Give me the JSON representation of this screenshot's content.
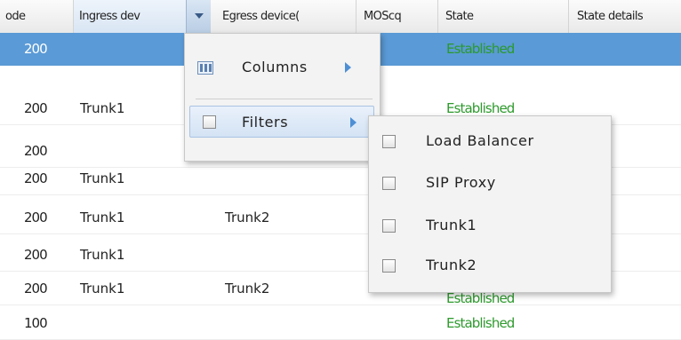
{
  "grid": {
    "columns": [
      {
        "key": "code",
        "label": "ode"
      },
      {
        "key": "ingress",
        "label": "Ingress dev"
      },
      {
        "key": "egress",
        "label": "Egress device("
      },
      {
        "key": "mos",
        "label": "MOScq"
      },
      {
        "key": "state",
        "label": "State"
      },
      {
        "key": "state_details",
        "label": "State details"
      }
    ],
    "rows": [
      {
        "code": "200",
        "ingress": "",
        "egress": "",
        "state": "Established",
        "selected": true
      },
      {
        "code": "200",
        "ingress": "Trunk1",
        "egress": "",
        "state": "Established",
        "selected": false
      },
      {
        "code": "200",
        "ingress": "",
        "egress": "",
        "state": "",
        "selected": false
      },
      {
        "code": "200",
        "ingress": "Trunk1",
        "egress": "",
        "state": "",
        "selected": false
      },
      {
        "code": "200",
        "ingress": "Trunk1",
        "egress": "Trunk2",
        "state": "",
        "selected": false
      },
      {
        "code": "200",
        "ingress": "Trunk1",
        "egress": "",
        "state": "",
        "selected": false
      },
      {
        "code": "200",
        "ingress": "Trunk1",
        "egress": "Trunk2",
        "state": "Established",
        "selected": false
      },
      {
        "code": "100",
        "ingress": "",
        "egress": "",
        "state": "Established",
        "selected": false
      }
    ]
  },
  "column_menu": {
    "columns_label": "Columns",
    "filters_label": "Filters"
  },
  "filters_submenu": {
    "items": [
      {
        "label": "Load Balancer",
        "checked": false
      },
      {
        "label": "SIP Proxy",
        "checked": false
      },
      {
        "label": "Trunk1",
        "checked": false
      },
      {
        "label": "Trunk2",
        "checked": false
      }
    ]
  },
  "colors": {
    "selected_row": "#5a9ad6",
    "established": "#2e9a2e",
    "menu_highlight": "#d4e3f4"
  }
}
